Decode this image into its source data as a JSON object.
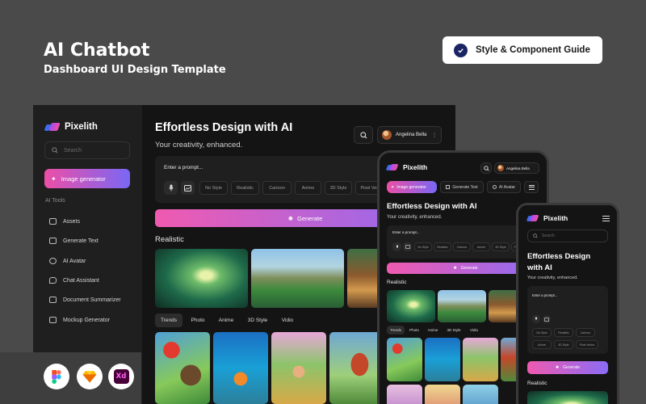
{
  "hero": {
    "title": "AI Chatbot",
    "subtitle": "Dashboard UI Design Template",
    "guide_button": "Style & Component Guide"
  },
  "brand": {
    "name": "Pixelith",
    "colors": {
      "pink": "#ec4fa6",
      "purple": "#7a67f5",
      "blue": "#3b6df0"
    }
  },
  "desktop": {
    "search_placeholder": "Search",
    "image_generator_button": "Image generator",
    "section_label": "AI Tools",
    "sidebar_items": [
      {
        "label": "Assets",
        "icon": "folder-icon"
      },
      {
        "label": "Generate Text",
        "icon": "document-icon"
      },
      {
        "label": "AI Avatar",
        "icon": "avatar-icon"
      },
      {
        "label": "Chat Assistant",
        "icon": "chat-icon"
      },
      {
        "label": "Document Summarizer",
        "icon": "summary-icon"
      },
      {
        "label": "Mockup Generator",
        "icon": "mockup-icon"
      }
    ],
    "title": "Effortless Design with AI",
    "subtitle": "Your creativity, enhanced.",
    "user_name": "Angelina Bella",
    "prompt_placeholder": "Enter a prompt...",
    "styles": [
      "No Style",
      "Realistic",
      "Cartoon",
      "Anime",
      "3D Style",
      "Pixel Vector"
    ],
    "generate_button": "Generate",
    "section_title": "Realistic",
    "tabs": [
      "Trends",
      "Photo",
      "Anime",
      "3D Style",
      "Vidio"
    ]
  },
  "tablet": {
    "brand": "Pixelith",
    "user_name": "Angelina Bella",
    "nav": [
      "Image generator",
      "Generate Text",
      "AI Avatar"
    ],
    "title": "Effortless Design with AI",
    "subtitle": "Your creativity, enhanced.",
    "prompt_placeholder": "Enter a prompt...",
    "styles": [
      "No Style",
      "Realistic",
      "Cartoon",
      "Anime",
      "3D Style",
      "Pixel Vector"
    ],
    "generate_button": "Generate",
    "section_title": "Realistic",
    "tabs": [
      "Trends",
      "Photo",
      "Anime",
      "3D Style",
      "Vidio"
    ]
  },
  "phone": {
    "brand": "Pixelith",
    "search_placeholder": "Search",
    "title_line1": "Effortless Design",
    "title_line2": "with AI",
    "subtitle": "Your creativity, enhanced.",
    "prompt_placeholder": "Enter a prompt...",
    "styles": [
      "No Style",
      "Realistic",
      "Cartoon",
      "Anime",
      "3D Style",
      "Pixel Vector"
    ],
    "generate_button": "Generate",
    "section_title": "Realistic"
  },
  "apps": {
    "xd_label": "Xd"
  }
}
